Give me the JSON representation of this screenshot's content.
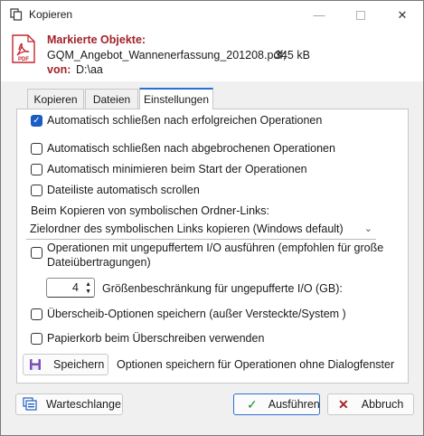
{
  "window": {
    "title": "Kopieren"
  },
  "header": {
    "label_selected": "Markierte Objekte:",
    "filename": "GQM_Angebot_Wannenerfassung_201208.pdf;",
    "filesize": "345 kB",
    "label_from": "von:",
    "path": "D:\\aa"
  },
  "tabs": [
    {
      "label": "Kopieren",
      "active": false
    },
    {
      "label": "Dateien",
      "active": false
    },
    {
      "label": "Einstellungen",
      "active": true
    }
  ],
  "settings": {
    "auto_close_success": {
      "label": "Automatisch schließen nach erfolgreichen Operationen",
      "checked": true
    },
    "auto_close_abort": {
      "label": "Automatisch schließen nach abgebrochenen Operationen",
      "checked": false
    },
    "auto_minimize": {
      "label": "Automatisch minimieren beim Start der Operationen",
      "checked": false
    },
    "auto_scroll": {
      "label": "Dateiliste automatisch scrollen",
      "checked": false
    },
    "symlink_label": "Beim Kopieren von symbolischen Ordner-Links:",
    "symlink_select": "Zielordner des symbolischen Links kopieren (Windows default)",
    "unbuffered": {
      "label_line1": "Operationen mit ungepuffertem I/O ausführen (empfohlen für große",
      "label_line2": "Dateiübertragungen)",
      "checked": false
    },
    "unbuffered_limit_value": "4",
    "unbuffered_limit_label": "Größenbeschränkung für ungepufferte I/O (GB):",
    "save_overwrite": {
      "label": "Überscheib-Optionen speichern (außer Versteckte/System )",
      "checked": false
    },
    "recycle_bin": {
      "label": "Papierkorb beim Überschreiben verwenden",
      "checked": false
    },
    "save_button": "Speichern",
    "save_hint": "Optionen speichern für Operationen ohne Dialogfenster"
  },
  "footer": {
    "queue_button": "Warteschlange",
    "execute_button": "Ausführen",
    "cancel_button": "Abbruch"
  },
  "colors": {
    "accent": "#1a5dc4",
    "label_red": "#a3232a"
  }
}
